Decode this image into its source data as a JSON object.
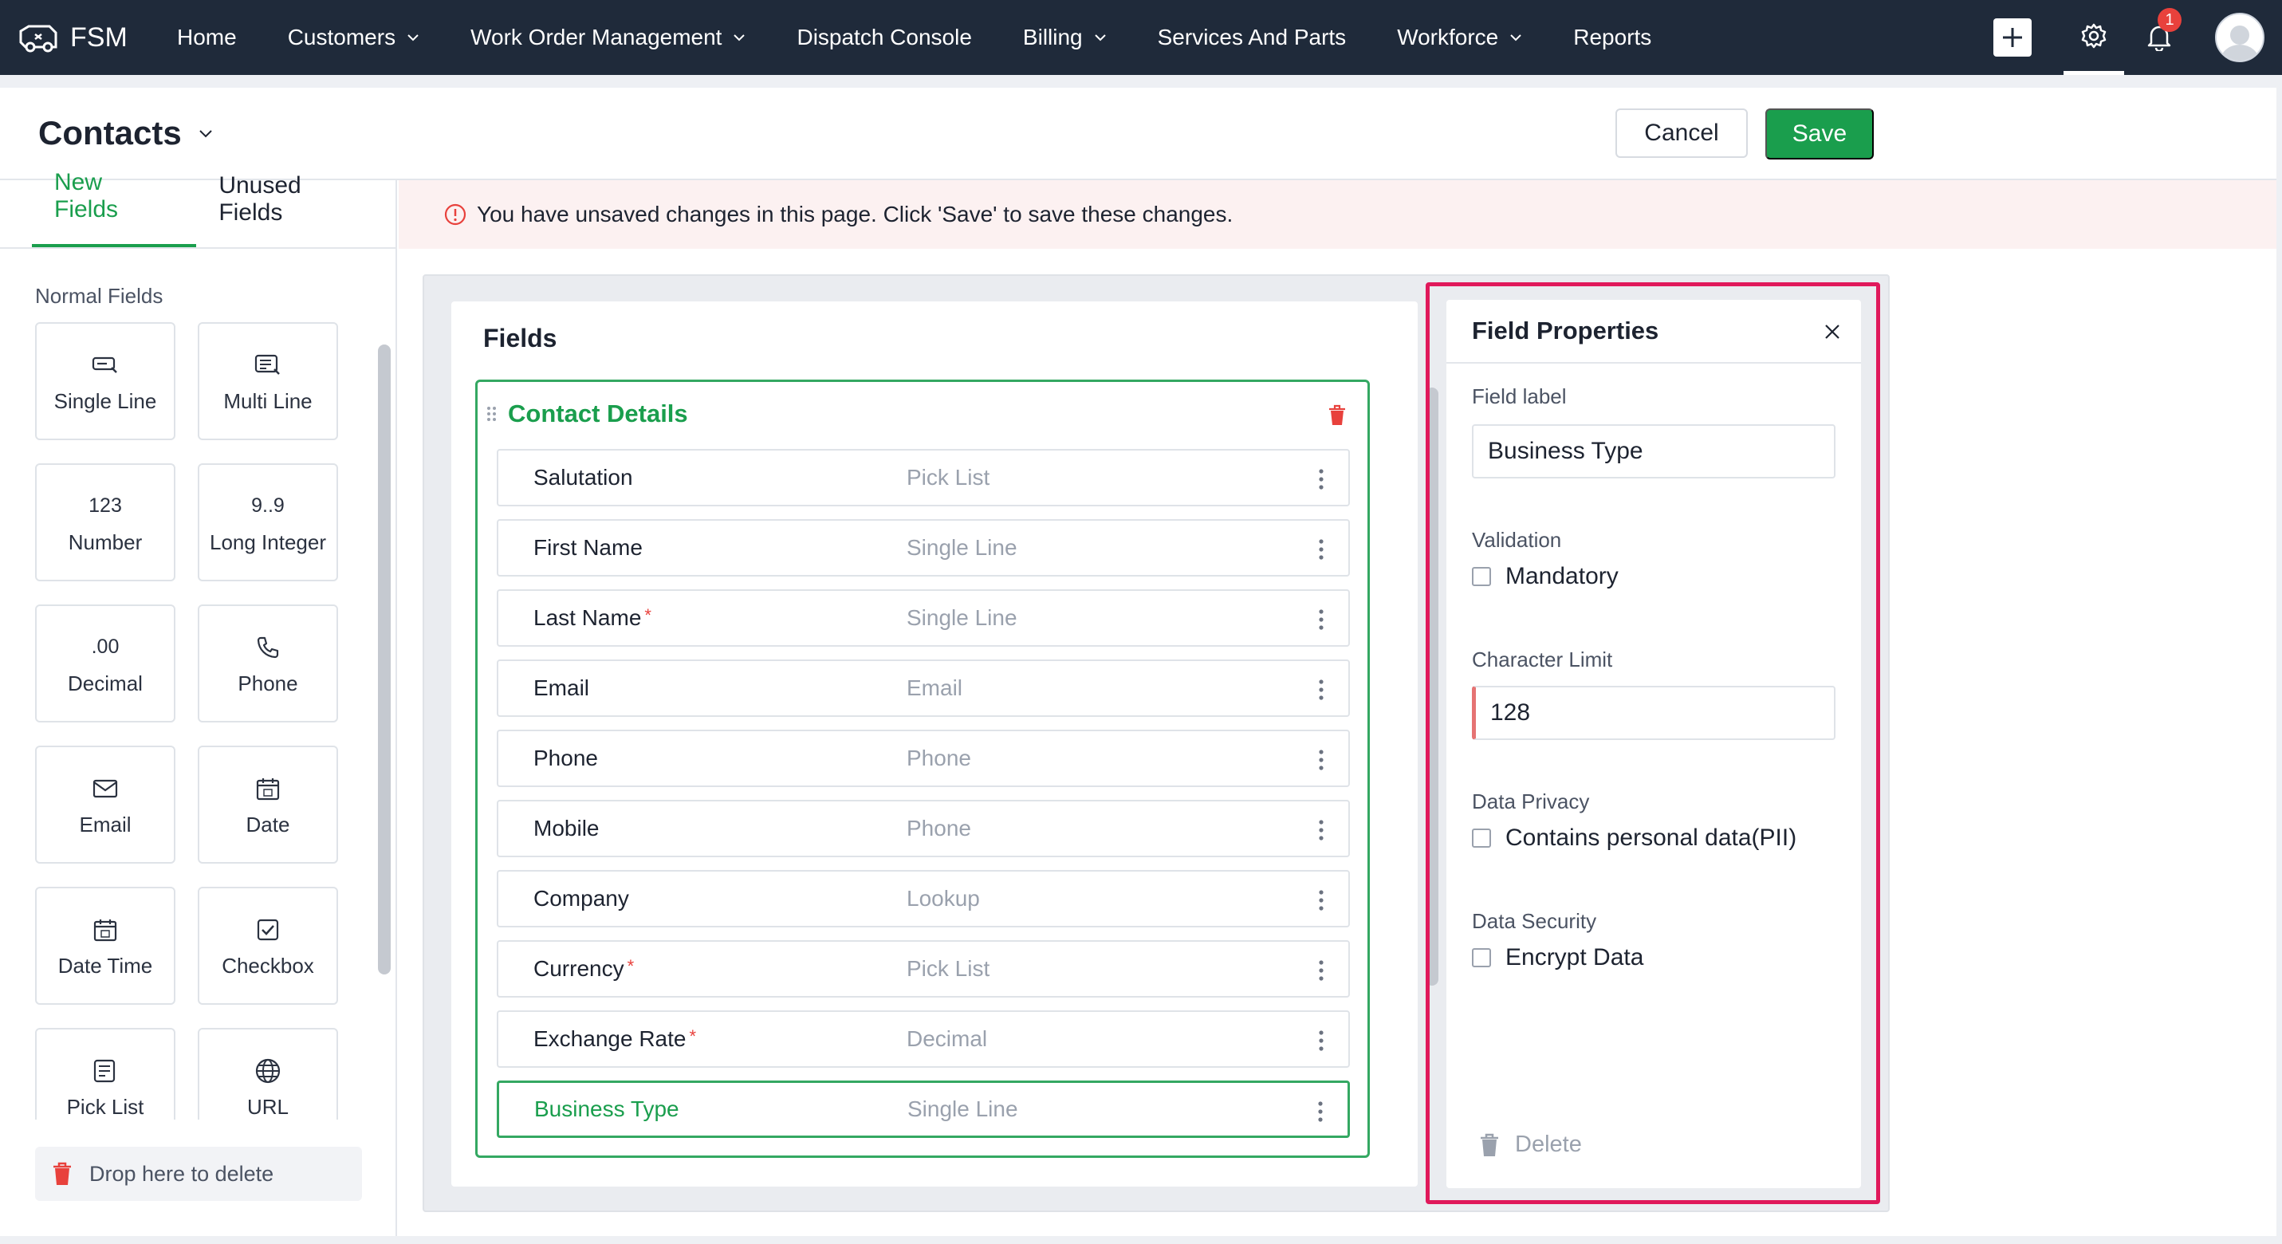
{
  "nav": {
    "brand": "FSM",
    "items": [
      {
        "label": "Home",
        "dropdown": false
      },
      {
        "label": "Customers",
        "dropdown": true
      },
      {
        "label": "Work Order Management",
        "dropdown": true
      },
      {
        "label": "Dispatch Console",
        "dropdown": false
      },
      {
        "label": "Billing",
        "dropdown": true
      },
      {
        "label": "Services And Parts",
        "dropdown": false
      },
      {
        "label": "Workforce",
        "dropdown": true
      },
      {
        "label": "Reports",
        "dropdown": false
      }
    ],
    "notification_count": "1"
  },
  "header": {
    "title": "Contacts",
    "cancel_label": "Cancel",
    "save_label": "Save"
  },
  "left_panel": {
    "tabs": [
      "New Fields",
      "Unused Fields"
    ],
    "section_label": "Normal Fields",
    "tiles": [
      {
        "label": "Single Line",
        "icon": "single-line-icon",
        "glyph": ""
      },
      {
        "label": "Multi Line",
        "icon": "multi-line-icon",
        "glyph": ""
      },
      {
        "label": "Number",
        "icon": "number-icon",
        "glyph": "123"
      },
      {
        "label": "Long Integer",
        "icon": "long-integer-icon",
        "glyph": "9..9"
      },
      {
        "label": "Decimal",
        "icon": "decimal-icon",
        "glyph": ".00"
      },
      {
        "label": "Phone",
        "icon": "phone-icon",
        "glyph": ""
      },
      {
        "label": "Email",
        "icon": "email-icon",
        "glyph": ""
      },
      {
        "label": "Date",
        "icon": "date-icon",
        "glyph": ""
      },
      {
        "label": "Date Time",
        "icon": "date-time-icon",
        "glyph": ""
      },
      {
        "label": "Checkbox",
        "icon": "checkbox-icon",
        "glyph": ""
      },
      {
        "label": "Pick List",
        "icon": "pick-list-icon",
        "glyph": ""
      },
      {
        "label": "URL",
        "icon": "globe-icon",
        "glyph": ""
      }
    ],
    "drop_zone_label": "Drop here to delete"
  },
  "banner": {
    "message": "You have unsaved changes in this page. Click 'Save' to save these changes."
  },
  "fields_panel": {
    "title": "Fields",
    "section_title": "Contact Details",
    "rows": [
      {
        "name": "Salutation",
        "type": "Pick List",
        "required": false,
        "selected": false
      },
      {
        "name": "First Name",
        "type": "Single Line",
        "required": false,
        "selected": false
      },
      {
        "name": "Last Name",
        "type": "Single Line",
        "required": true,
        "selected": false
      },
      {
        "name": "Email",
        "type": "Email",
        "required": false,
        "selected": false
      },
      {
        "name": "Phone",
        "type": "Phone",
        "required": false,
        "selected": false
      },
      {
        "name": "Mobile",
        "type": "Phone",
        "required": false,
        "selected": false
      },
      {
        "name": "Company",
        "type": "Lookup",
        "required": false,
        "selected": false
      },
      {
        "name": "Currency",
        "type": "Pick List",
        "required": true,
        "selected": false
      },
      {
        "name": "Exchange Rate",
        "type": "Decimal",
        "required": true,
        "selected": false
      },
      {
        "name": "Business Type",
        "type": "Single Line",
        "required": false,
        "selected": true
      }
    ],
    "required_marker": "*"
  },
  "properties": {
    "title": "Field Properties",
    "field_label_caption": "Field label",
    "field_label_value": "Business Type",
    "validation_caption": "Validation",
    "mandatory_label": "Mandatory",
    "char_limit_caption": "Character Limit",
    "char_limit_value": "128",
    "privacy_caption": "Data Privacy",
    "pii_label": "Contains personal data(PII)",
    "security_caption": "Data Security",
    "encrypt_label": "Encrypt Data",
    "delete_label": "Delete"
  },
  "colors": {
    "nav_bg": "#1f2a3a",
    "accent_green": "#1a9e4d",
    "highlight_pink": "#e0195b",
    "required_red": "#e8413c"
  }
}
